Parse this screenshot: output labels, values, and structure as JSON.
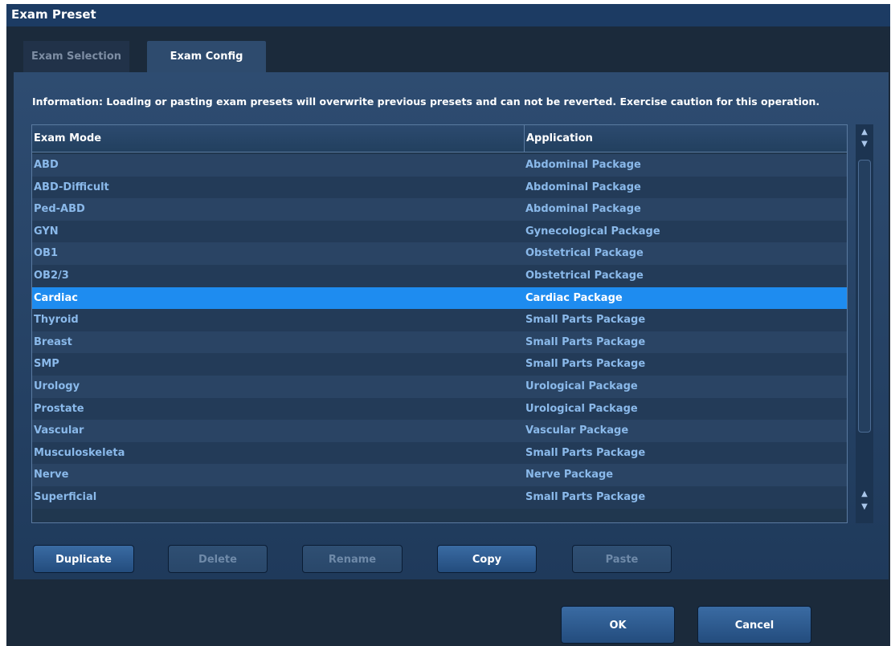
{
  "window": {
    "title": "Exam Preset"
  },
  "tabs": [
    {
      "label": "Exam Selection",
      "active": false
    },
    {
      "label": "Exam Config",
      "active": true
    }
  ],
  "info": "Information: Loading or pasting exam presets will overwrite previous presets and can not be reverted. Exercise caution for this operation.",
  "table": {
    "columns": [
      "Exam Mode",
      "Application"
    ],
    "rows": [
      [
        "ABD",
        "Abdominal Package"
      ],
      [
        "ABD-Difficult",
        "Abdominal Package"
      ],
      [
        "Ped-ABD",
        "Abdominal Package"
      ],
      [
        "GYN",
        "Gynecological Package"
      ],
      [
        "OB1",
        "Obstetrical Package"
      ],
      [
        "OB2/3",
        "Obstetrical Package"
      ],
      [
        "Cardiac",
        "Cardiac Package"
      ],
      [
        "Thyroid",
        "Small Parts Package"
      ],
      [
        "Breast",
        "Small Parts Package"
      ],
      [
        "SMP",
        "Small Parts Package"
      ],
      [
        "Urology",
        "Urological Package"
      ],
      [
        "Prostate",
        "Urological Package"
      ],
      [
        "Vascular",
        "Vascular Package"
      ],
      [
        "Musculoskeleta",
        "Small Parts Package"
      ],
      [
        "Nerve",
        "Nerve Package"
      ],
      [
        "Superficial",
        "Small Parts Package"
      ]
    ],
    "selected_row": "Cardiac"
  },
  "buttons": {
    "duplicate": "Duplicate",
    "delete": "Delete",
    "rename": "Rename",
    "copy": "Copy",
    "paste": "Paste",
    "ok": "OK",
    "cancel": "Cancel"
  },
  "colors": {
    "selection": "#1e8cf0",
    "row_text": "#8ab9ea",
    "titlebar": "#1c3b63"
  }
}
